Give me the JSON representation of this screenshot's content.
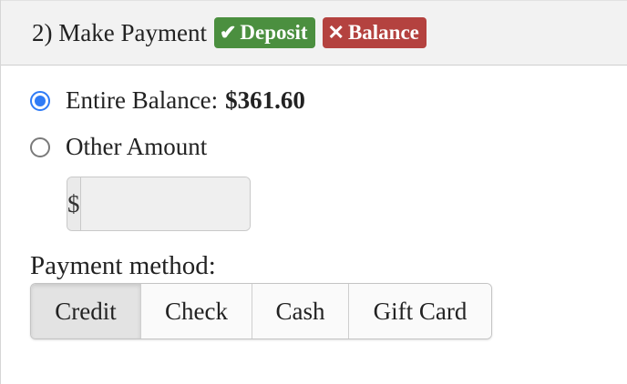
{
  "header": {
    "title": "2) Make Payment",
    "badges": [
      {
        "icon": "check-icon",
        "label": "Deposit",
        "color": "#4b8f3f"
      },
      {
        "icon": "x-icon",
        "label": "Balance",
        "color": "#b4423f"
      }
    ]
  },
  "payment_options": {
    "entire_balance_label": "Entire Balance:",
    "entire_balance_amount": "$361.60",
    "other_amount_label": "Other Amount",
    "selected": "entire_balance"
  },
  "amount_input": {
    "currency_symbol": "$",
    "value": ""
  },
  "payment_method": {
    "label": "Payment method:",
    "options": [
      "Credit",
      "Check",
      "Cash",
      "Gift Card"
    ],
    "selected": "Credit"
  },
  "colors": {
    "radio_accent": "#2f7bf6"
  }
}
